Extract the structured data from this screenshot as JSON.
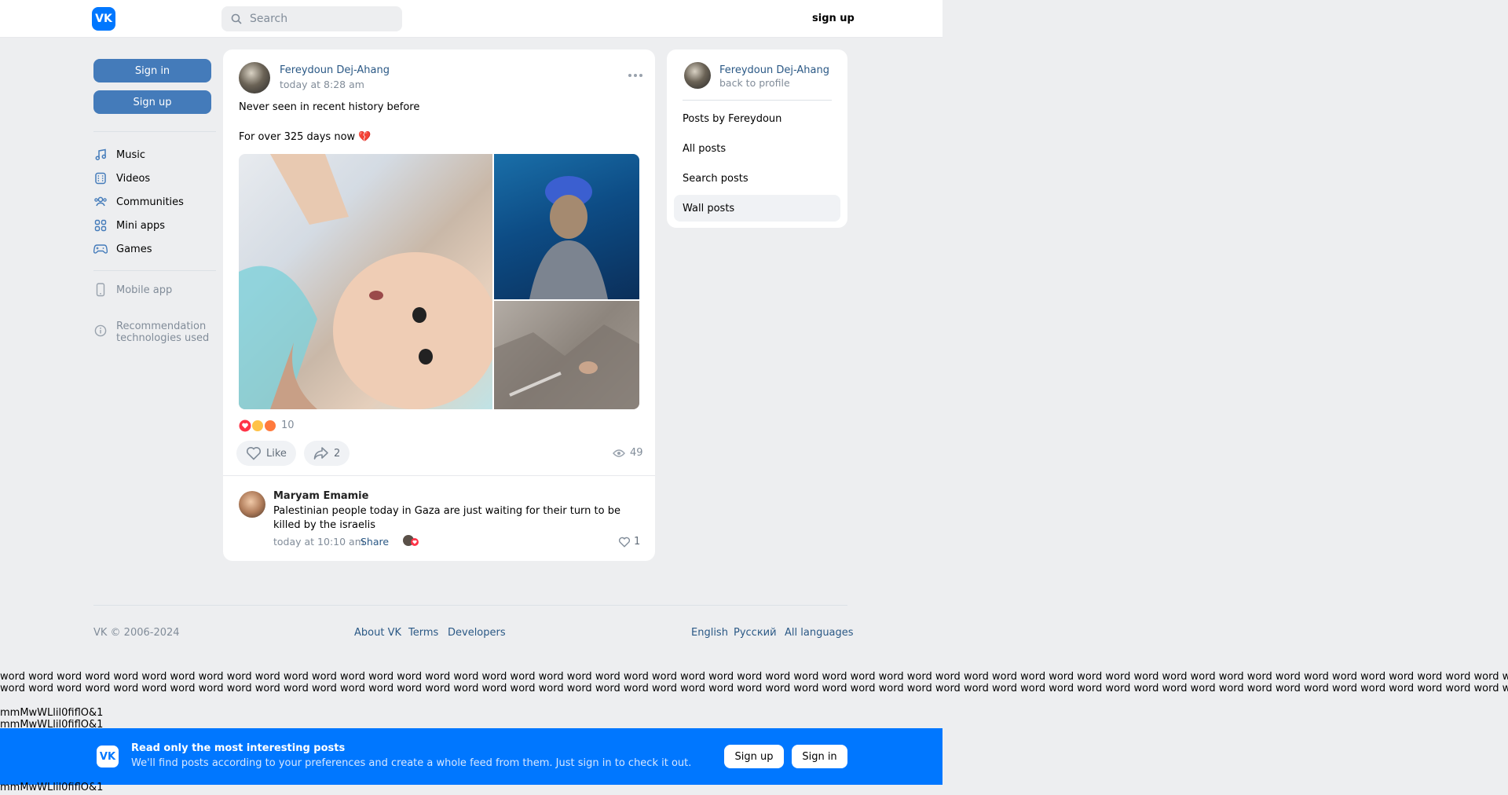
{
  "header": {
    "logo": "VK",
    "search_placeholder": "Search",
    "signup": "sign up"
  },
  "left": {
    "sign_in": "Sign in",
    "sign_up": "Sign up",
    "menu": [
      {
        "label": "Music",
        "icon": "music-note-icon"
      },
      {
        "label": "Videos",
        "icon": "video-film-icon"
      },
      {
        "label": "Communities",
        "icon": "people-icon"
      },
      {
        "label": "Mini apps",
        "icon": "grid-apps-icon"
      },
      {
        "label": "Games",
        "icon": "gamepad-icon"
      }
    ],
    "mobile_app": "Mobile app",
    "recommendation": "Recommendation technologies used"
  },
  "post": {
    "author": "Fereydoun Dej-Ahang",
    "time": "today at 8:28 am",
    "text_line1": "Never seen in recent history before",
    "text_line2": "For over 325 days now 💔",
    "reactions_count": "10",
    "like_label": "Like",
    "share_count": "2",
    "views": "49"
  },
  "comment": {
    "author": "Maryam Emamie",
    "text": "Palestinian people today in Gaza are just waiting for their turn to be killed by the israelis",
    "time": "today at 10:10 am",
    "share": "Share",
    "likes": "1"
  },
  "right": {
    "name": "Fereydoun Dej-Ahang",
    "back": "back to profile",
    "items": [
      "Posts by Fereydoun",
      "All posts",
      "Search posts",
      "Wall posts"
    ]
  },
  "footer": {
    "copyright": "VK © 2006-2024",
    "about": "About VK",
    "terms": "Terms",
    "developers": "Developers",
    "english": "English",
    "russian": "Русский",
    "all_languages": "All languages"
  },
  "debug": {
    "word_line": "word word word word word word word word word word word word word word word word word word word word word word word word word word word word word word word word word word word word word word word word word word word word word word word word word word word word word word word word word word word word word word word word word word word word word",
    "mono": "mmMwWLlil0fiflO&1"
  },
  "banner": {
    "logo": "VK",
    "title": "Read only the most interesting posts",
    "subtitle": "We'll find posts according to your preferences and create a whole feed from them. Just sign in to check it out.",
    "sign_up": "Sign up",
    "sign_in": "Sign in"
  },
  "colors": {
    "vk_blue": "#0077ff",
    "button_blue": "#447bba",
    "link": "#2a5885"
  }
}
